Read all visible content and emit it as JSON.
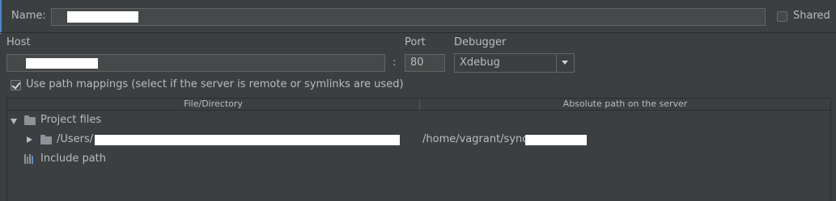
{
  "name": {
    "label": "Name:",
    "value": ""
  },
  "shared": {
    "label": "Shared",
    "checked": false
  },
  "host": {
    "label": "Host",
    "value": ""
  },
  "port": {
    "label": "Port",
    "colon": ":",
    "value": "80"
  },
  "debugger": {
    "label": "Debugger",
    "selected": "Xdebug"
  },
  "path_mappings": {
    "label": "Use path mappings (select if the server is remote or symlinks are used)",
    "checked": true
  },
  "table": {
    "columns": [
      "File/Directory",
      "Absolute path on the server"
    ],
    "project_files": "Project files",
    "row": {
      "local_path": "/Users/",
      "server_path": "/home/vagrant/sync"
    },
    "include_path": "Include path"
  },
  "icons": [
    "folder-icon",
    "chevron-down-icon",
    "chevron-right-icon",
    "library-icon",
    "checkbox-icon",
    "dropdown-arrow-icon"
  ],
  "colors": {
    "background": "#3c3f41",
    "field": "#45494a",
    "text": "#bbbbbb",
    "accent": "#4a88c7",
    "redaction": "#ffffff"
  }
}
